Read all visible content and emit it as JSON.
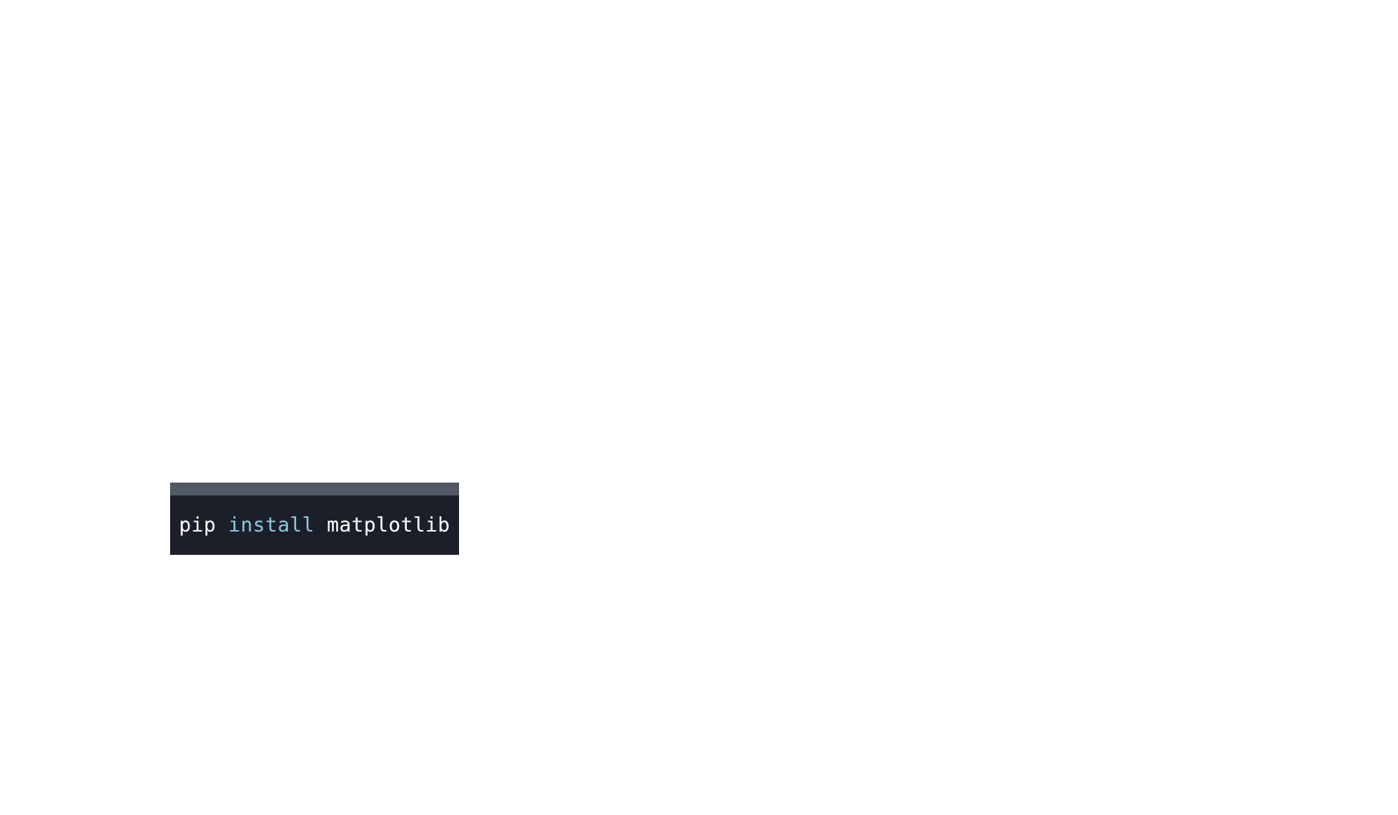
{
  "code_block": {
    "tokens": [
      {
        "text": "pip",
        "kind": "plain"
      },
      {
        "text": " ",
        "kind": "plain"
      },
      {
        "text": "install",
        "kind": "keyword"
      },
      {
        "text": " ",
        "kind": "plain"
      },
      {
        "text": "matplotlib",
        "kind": "plain"
      }
    ],
    "colors": {
      "background": "#1b1f29",
      "header": "#535866",
      "plain": "#ffffff",
      "keyword": "#8ec7dd"
    }
  }
}
